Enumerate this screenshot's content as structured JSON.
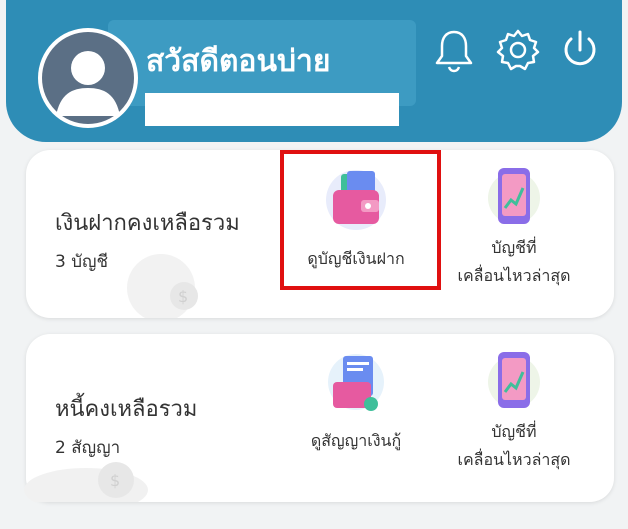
{
  "header": {
    "greeting": "สวัสดีตอนบ่าย",
    "user_name": ""
  },
  "header_icons": [
    "bell-icon",
    "settings-icon",
    "power-icon"
  ],
  "cards": [
    {
      "title": "เงินฝากคงเหลือรวม",
      "subtitle": "3 บัญชี",
      "actions": [
        {
          "label": "ดูบัญชีเงินฝาก",
          "icon": "wallet-icon"
        },
        {
          "label_line1": "บัญชีที่",
          "label_line2": "เคลื่อนไหวล่าสุด",
          "icon": "phone-transactions-icon"
        }
      ]
    },
    {
      "title": "หนี้คงเหลือรวม",
      "subtitle": "2 สัญญา",
      "actions": [
        {
          "label": "ดูสัญญาเงินกู้",
          "icon": "loan-contract-icon"
        },
        {
          "label_line1": "บัญชีที่",
          "label_line2": "เคลื่อนไหวล่าสุด",
          "icon": "phone-transactions-icon"
        }
      ]
    }
  ],
  "colors": {
    "header_bg": "#2e8db6",
    "highlight": "#e01010",
    "background": "#f1f3f4"
  }
}
